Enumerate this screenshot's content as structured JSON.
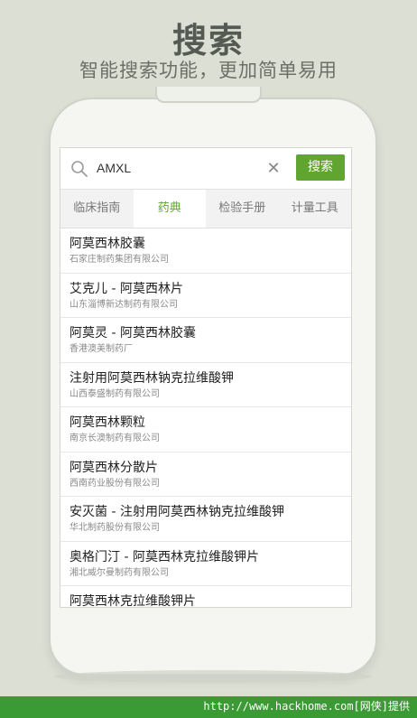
{
  "promo": {
    "title": "搜索",
    "subtitle": "智能搜索功能，更加简单易用"
  },
  "search": {
    "query": "AMXL",
    "button_label": "搜索"
  },
  "tabs": [
    {
      "label": "临床指南",
      "active": false
    },
    {
      "label": "药典",
      "active": true
    },
    {
      "label": "检验手册",
      "active": false
    },
    {
      "label": "计量工具",
      "active": false
    }
  ],
  "results": [
    {
      "name": "阿莫西林胶囊",
      "company": "石家庄制药集团有限公司"
    },
    {
      "name": "艾克儿 - 阿莫西林片",
      "company": "山东淄博新达制药有限公司"
    },
    {
      "name": "阿莫灵 - 阿莫西林胶囊",
      "company": "香港澳美制药厂"
    },
    {
      "name": "注射用阿莫西林钠克拉维酸钾",
      "company": "山西泰盛制药有限公司"
    },
    {
      "name": "阿莫西林颗粒",
      "company": "南京长澳制药有限公司"
    },
    {
      "name": "阿莫西林分散片",
      "company": "西南药业股份有限公司"
    },
    {
      "name": "安灭菌 - 注射用阿莫西林钠克拉维酸钾",
      "company": "华北制药股份有限公司"
    },
    {
      "name": "奥格门汀 - 阿莫西林克拉维酸钾片",
      "company": "湘北威尔曼制药有限公司"
    },
    {
      "name": "阿莫西林克拉维酸钾片",
      "company": ""
    }
  ],
  "footer": {
    "text": "http://www.hackhome.com[网侠]提供"
  },
  "colors": {
    "accent": "#5fa52f",
    "background": "#dcdfd4",
    "footer": "#3a9a33"
  }
}
